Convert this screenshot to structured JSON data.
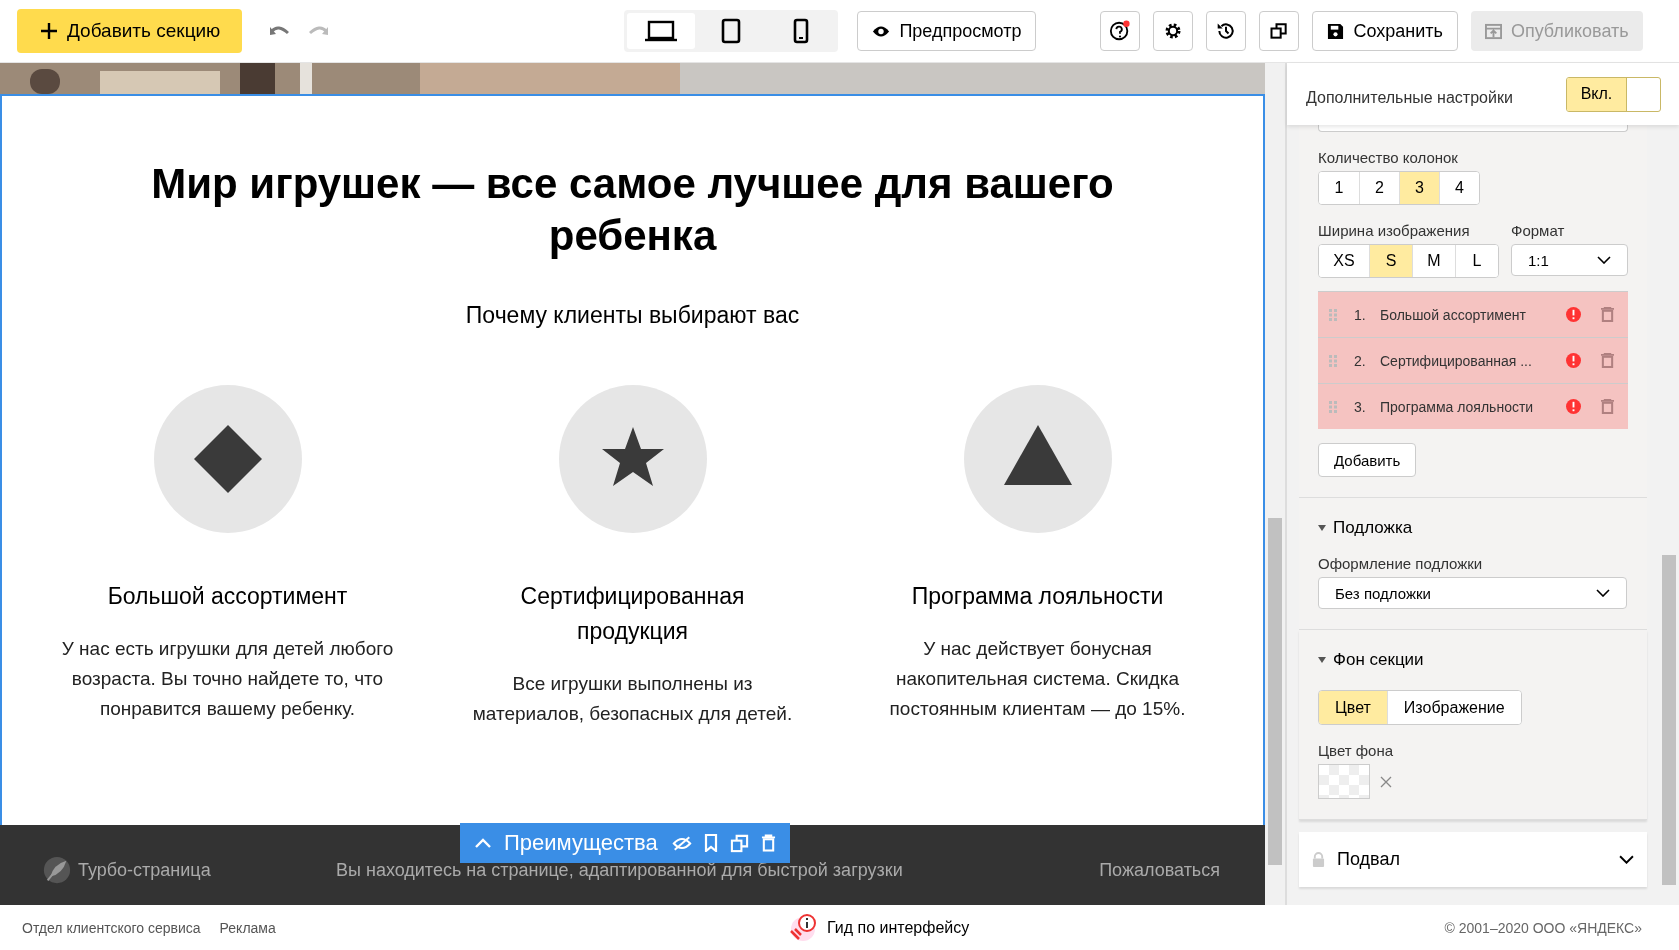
{
  "toolbar": {
    "add_section": "Добавить секцию",
    "devices": [
      {
        "kind": "desktop",
        "selected": true
      },
      {
        "kind": "tablet",
        "selected": false
      },
      {
        "kind": "phone",
        "selected": false
      }
    ],
    "preview": "Предпросмотр",
    "save": "Сохранить",
    "publish": {
      "label": "Опубликовать",
      "disabled": true
    }
  },
  "section": {
    "heading": "Мир игрушек — все самое лучшее для вашего ребенка",
    "subheading": "Почему клиенты выбирают вас",
    "features": [
      {
        "kind": "diamond",
        "title": "Большой ассортимент",
        "text": "У нас есть игрушки для детей любого возраста. Вы точно найдете то, что понравится вашему ребенку."
      },
      {
        "kind": "star",
        "title": "Сертифицированная продукция",
        "text": "Все игрушки выполнены из материалов, безопасных для детей."
      },
      {
        "kind": "triangle",
        "title": "Программа лояльности",
        "text": "У нас действует бонусная накопительная система. Скидка постоянным клиентам — до 15%."
      }
    ]
  },
  "section_toolbar": {
    "label": "Преимущества"
  },
  "turbo_footer": {
    "brand": "Турбо-страница",
    "notice": "Вы находитесь на странице, адаптированной для быстрой загрузки",
    "report": "Пожаловаться"
  },
  "panel": {
    "extra_settings": {
      "label": "Дополнительные настройки",
      "toggle": "Вкл.",
      "on": true
    },
    "columns": {
      "label": "Количество колонок",
      "options": [
        {
          "label": "1",
          "selected": false
        },
        {
          "label": "2",
          "selected": false
        },
        {
          "label": "3",
          "selected": true
        },
        {
          "label": "4",
          "selected": false
        }
      ]
    },
    "image_width": {
      "label": "Ширина изображения",
      "options": [
        {
          "label": "XS",
          "selected": false
        },
        {
          "label": "S",
          "selected": true
        },
        {
          "label": "M",
          "selected": false
        },
        {
          "label": "L",
          "selected": false
        }
      ]
    },
    "format": {
      "label": "Формат",
      "value": "1:1"
    },
    "items": [
      {
        "number": "1.",
        "title": "Большой ассортимент",
        "error": true
      },
      {
        "number": "2.",
        "title": "Сертифицированная ...",
        "error": true
      },
      {
        "number": "3.",
        "title": "Программа лояльности",
        "error": true
      }
    ],
    "add": "Добавить",
    "backing": {
      "title": "Подложка",
      "expanded": true,
      "field_label": "Оформление подложки",
      "value": "Без подложки"
    },
    "section_bg": {
      "title": "Фон секции",
      "expanded": true,
      "tabs": [
        {
          "label": "Цвет",
          "selected": true
        },
        {
          "label": "Изображение",
          "selected": false
        }
      ],
      "color_label": "Цвет фона"
    },
    "footer_section": {
      "label": "Подвал",
      "locked": true
    }
  },
  "bottom": {
    "links": [
      "Отдел клиентского сервиса",
      "Реклама"
    ],
    "guide": "Гид по интерфейсу",
    "copyright": "© 2001–2020 ООО «ЯНДЕКС»"
  }
}
